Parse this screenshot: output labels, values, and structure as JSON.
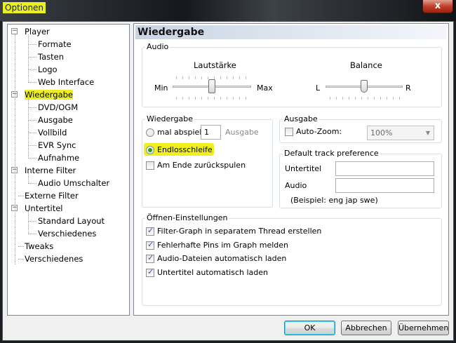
{
  "window": {
    "title": "Optionen",
    "close": "x"
  },
  "tree": [
    {
      "label": "Player",
      "level": 0,
      "expander": "−"
    },
    {
      "label": "Formate",
      "level": 1
    },
    {
      "label": "Tasten",
      "level": 1
    },
    {
      "label": "Logo",
      "level": 1
    },
    {
      "label": "Web Interface",
      "level": 1
    },
    {
      "label": "Wiedergabe",
      "level": 0,
      "expander": "−",
      "highlighted": true,
      "selected": true
    },
    {
      "label": "DVD/OGM",
      "level": 1
    },
    {
      "label": "Ausgabe",
      "level": 1
    },
    {
      "label": "Vollbild",
      "level": 1
    },
    {
      "label": "EVR Sync",
      "level": 1
    },
    {
      "label": "Aufnahme",
      "level": 1
    },
    {
      "label": "Interne Filter",
      "level": 0,
      "expander": "−"
    },
    {
      "label": "Audio Umschalter",
      "level": 1
    },
    {
      "label": "Externe Filter",
      "level": 0
    },
    {
      "label": "Untertitel",
      "level": 0,
      "expander": "−"
    },
    {
      "label": "Standard Layout",
      "level": 1
    },
    {
      "label": "Verschiedenes",
      "level": 1
    },
    {
      "label": "Tweaks",
      "level": 0
    },
    {
      "label": "Verschiedenes",
      "level": 0
    }
  ],
  "page": {
    "title": "Wiedergabe"
  },
  "audio": {
    "group": "Audio",
    "volume_label": "Lautstärke",
    "volume_min": "Min",
    "volume_max": "Max",
    "volume_value": 0.5,
    "balance_label": "Balance",
    "balance_left": "L",
    "balance_right": "R",
    "balance_value": 0.5
  },
  "playback": {
    "group": "Wiedergabe",
    "repeat_label": "mal abspiele",
    "repeat_count": "1",
    "repeat_suffix": "Ausgabe",
    "loop_label": "Endlosschleife",
    "loop_selected": true,
    "rewind_label": "Am Ende zurückspulen",
    "rewind_checked": false
  },
  "output": {
    "group": "Ausgabe",
    "autozoom_label": "Auto-Zoom:",
    "autozoom_checked": false,
    "zoom_value": "100%"
  },
  "track_pref": {
    "group": "Default track preference",
    "subtitle_label": "Untertitel",
    "subtitle_value": "",
    "audio_label": "Audio",
    "audio_value": "",
    "example": "(Beispiel: eng jap swe)"
  },
  "open_settings": {
    "group": "Öffnen-Einstellungen",
    "items": [
      {
        "label": "Filter-Graph in separatem Thread erstellen",
        "checked": true
      },
      {
        "label": "Fehlerhafte Pins im Graph melden",
        "checked": true
      },
      {
        "label": "Audio-Dateien automatisch laden",
        "checked": true
      },
      {
        "label": "Untertitel automatisch laden",
        "checked": true
      }
    ]
  },
  "buttons": {
    "ok": "OK",
    "cancel": "Abbrechen",
    "apply": "Übernehmen"
  },
  "colors": {
    "highlight": "#f0f020",
    "radio_selected": "#2a9a2a"
  }
}
